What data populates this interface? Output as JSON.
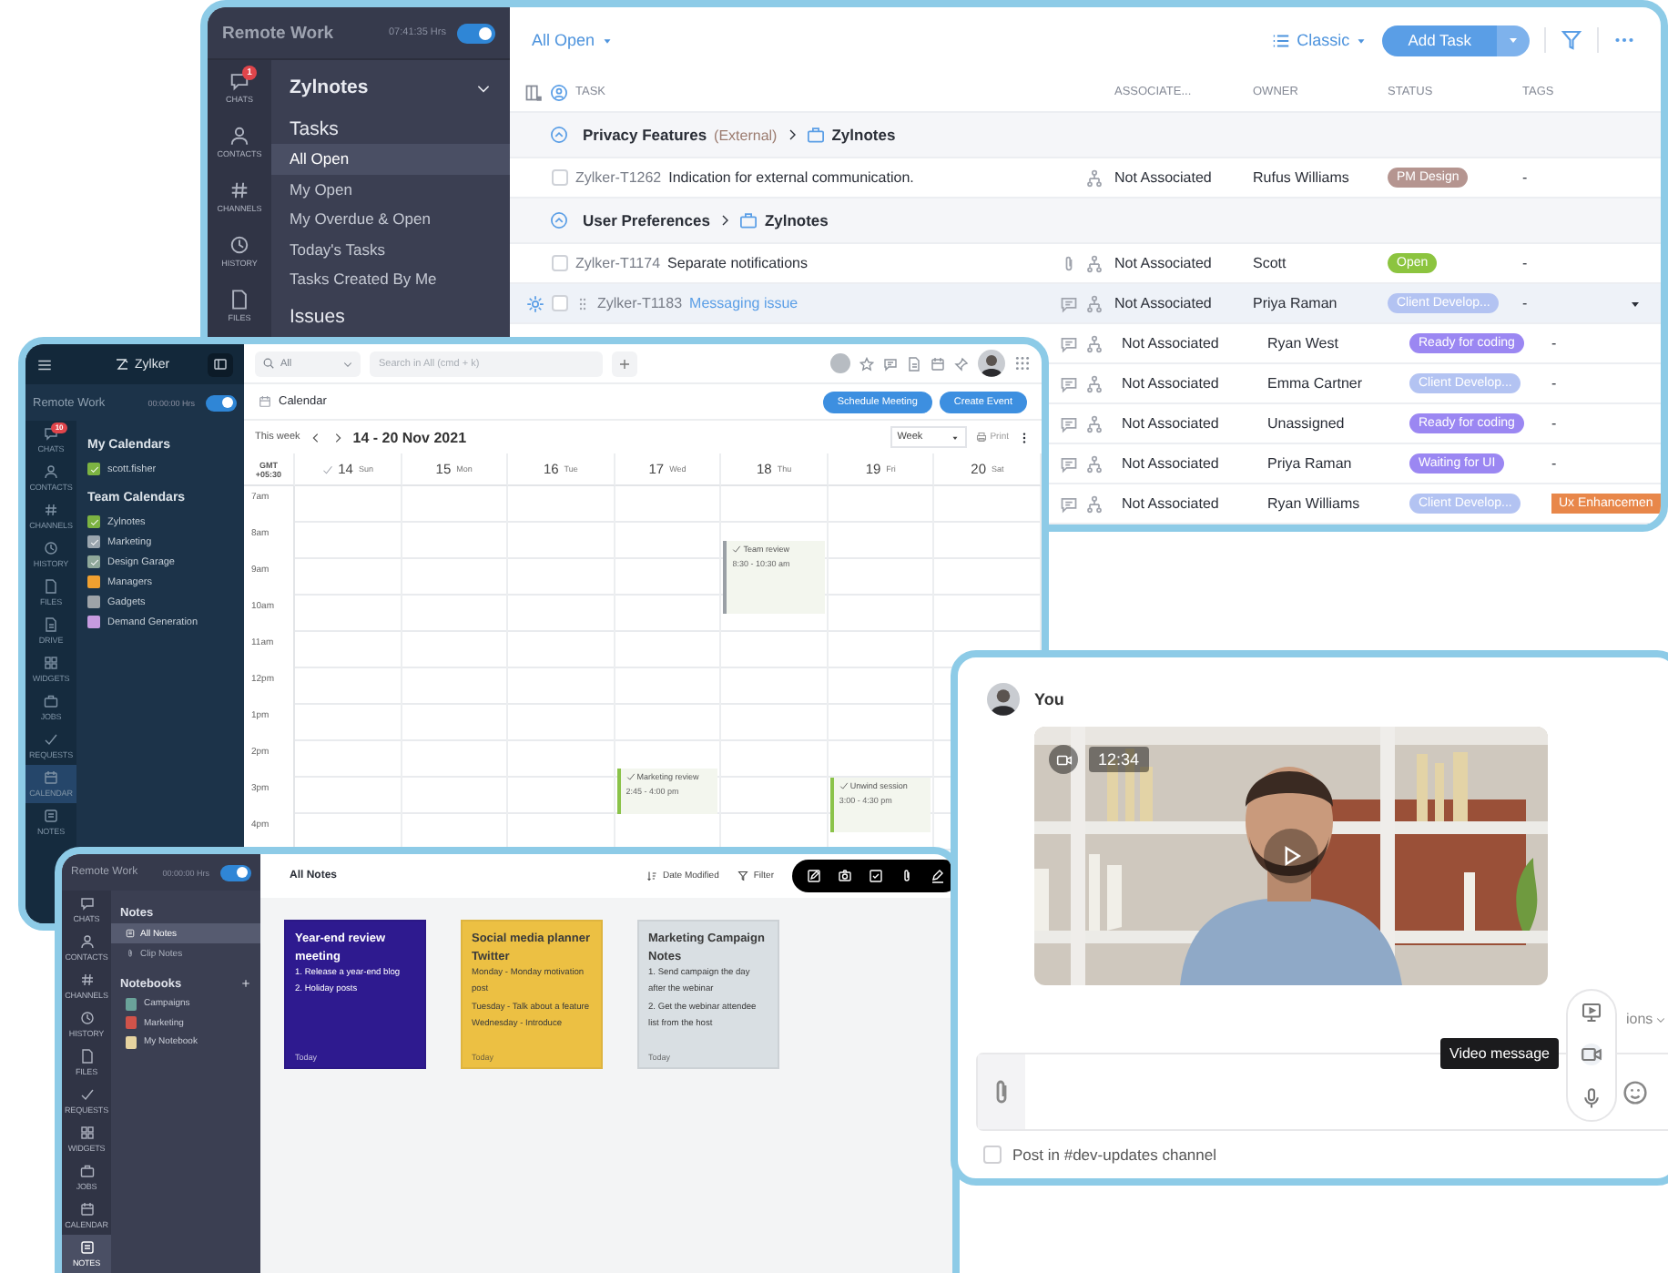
{
  "tasks_window": {
    "title": "Remote Work",
    "timer": "07:41:35 Hrs",
    "timer_on": true,
    "rail": [
      {
        "label": "CHATS",
        "badge": "1"
      },
      {
        "label": "CONTACTS"
      },
      {
        "label": "CHANNELS"
      },
      {
        "label": "HISTORY"
      },
      {
        "label": "FILES"
      }
    ],
    "project": "Zylnotes",
    "section": "Tasks",
    "views": [
      {
        "label": "All Open",
        "selected": true
      },
      {
        "label": "My Open",
        "selected": false
      },
      {
        "label": "My Overdue & Open",
        "selected": false
      },
      {
        "label": "Today's Tasks",
        "selected": false
      },
      {
        "label": "Tasks Created By Me",
        "selected": false
      }
    ],
    "section_2": "Issues",
    "filter_menu": "All Open",
    "layout_menu": "Classic",
    "add_button": "Add Task",
    "columns": [
      "TASK",
      "ASSOCIATE...",
      "OWNER",
      "STATUS",
      "TAGS"
    ],
    "rows": [
      {
        "kind": "group",
        "name": "Privacy Features",
        "note": "(External)",
        "project": "Zylnotes",
        "expanded": true
      },
      {
        "kind": "task",
        "id": "Zylker-T1262",
        "task": "Indication for external communication.",
        "commented": false,
        "attached": false,
        "associate": "Not Associated",
        "owner": "Rufus Williams",
        "status": {
          "label": "PM Design",
          "color": "#b59590"
        },
        "tags": "-",
        "selected": false
      },
      {
        "kind": "group",
        "name": "User Preferences",
        "project": "Zylnotes",
        "expanded": true
      },
      {
        "kind": "task",
        "id": "Zylker-T1174",
        "task": "Separate notifications",
        "commented": false,
        "attached": true,
        "associate": "Not Associated",
        "owner": "Scott",
        "status": {
          "label": "Open",
          "color": "#8cc43f"
        },
        "tags": "-",
        "selected": false
      },
      {
        "kind": "task",
        "id": "Zylker-T1183",
        "task": "Messaging issue",
        "commented": true,
        "attached": false,
        "associate": "Not Associated",
        "owner": "Priya Raman",
        "status": {
          "label": "Client Develop...",
          "color": "#b3c3f2"
        },
        "tags": "-",
        "selected": true
      },
      {
        "kind": "task",
        "commented": true,
        "attached": false,
        "associate": "Not Associated",
        "owner": "Ryan West",
        "status": {
          "label": "Ready for coding",
          "color": "#9b87f2"
        },
        "tags": "-",
        "selected": false
      },
      {
        "kind": "task",
        "commented": true,
        "attached": false,
        "associate": "Not Associated",
        "owner": "Emma Cartner",
        "status": {
          "label": "Client Develop...",
          "color": "#b3c3f2"
        },
        "tags": "-",
        "selected": false
      },
      {
        "kind": "task",
        "commented": true,
        "attached": false,
        "associate": "Not Associated",
        "owner": "Unassigned",
        "status": {
          "label": "Ready for coding",
          "color": "#9b87f2"
        },
        "tags": "-",
        "selected": false
      },
      {
        "kind": "task",
        "commented": true,
        "attached": false,
        "associate": "Not Associated",
        "owner": "Priya Raman",
        "status": {
          "label": "Waiting for UI",
          "color": "#9b87f2"
        },
        "tags": "-",
        "selected": false
      },
      {
        "kind": "task",
        "commented": true,
        "attached": false,
        "associate": "Not Associated",
        "owner": "Ryan Williams",
        "status": {
          "label": "Client Develop...",
          "color": "#b3c3f2"
        },
        "tag": {
          "label": "Ux Enhancemen",
          "color": "#e8874a"
        },
        "selected": false
      }
    ]
  },
  "calendar_window": {
    "app": "Zylker",
    "title": "Remote Work",
    "timer": "00:00:00 Hrs",
    "timer_on": true,
    "rail": [
      {
        "label": "CHATS",
        "badge": "10",
        "selected": false
      },
      {
        "label": "CONTACTS",
        "selected": false
      },
      {
        "label": "CHANNELS",
        "selected": false
      },
      {
        "label": "HISTORY",
        "selected": false
      },
      {
        "label": "FILES",
        "selected": false
      },
      {
        "label": "DRIVE",
        "selected": false
      },
      {
        "label": "WIDGETS",
        "selected": false
      },
      {
        "label": "JOBS",
        "selected": false
      },
      {
        "label": "REQUESTS",
        "selected": false
      },
      {
        "label": "CALENDAR",
        "selected": true
      },
      {
        "label": "NOTES",
        "selected": false
      }
    ],
    "my_calendars_title": "My Calendars",
    "my_calendars": [
      {
        "label": "scott.fisher",
        "color": "#7cb342",
        "checked": true
      }
    ],
    "team_calendars_title": "Team Calendars",
    "team_calendars": [
      {
        "label": "Zylnotes",
        "color": "#7cb342",
        "checked": true
      },
      {
        "label": "Marketing",
        "color": "#9aa5ae",
        "checked": true
      },
      {
        "label": "Design Garage",
        "color": "#8fa89a",
        "checked": true
      },
      {
        "label": "Managers",
        "color": "#f0a030",
        "checked": false
      },
      {
        "label": "Gadgets",
        "color": "#9ea3a8",
        "checked": false
      },
      {
        "label": "Demand Generation",
        "color": "#c79be0",
        "checked": false
      }
    ],
    "scope": "All",
    "search_placeholder": "Search in All (cmd + k)",
    "module": "Calendar",
    "actions": [
      "Schedule Meeting",
      "Create Event"
    ],
    "range_label": "This week",
    "range": "14 - 20 Nov 2021",
    "view": "Week",
    "print": "Print",
    "timezone": "GMT",
    "offset": "+05:30",
    "days": [
      {
        "date": "14",
        "day": "Sun"
      },
      {
        "date": "15",
        "day": "Mon"
      },
      {
        "date": "16",
        "day": "Tue"
      },
      {
        "date": "17",
        "day": "Wed",
        "events": [
          {
            "title": "Marketing review",
            "time": "2:45 - 4:00 pm",
            "color": "#8bc34a"
          }
        ]
      },
      {
        "date": "18",
        "day": "Thu",
        "events": [
          {
            "title": "Team review",
            "time": "8:30 - 10:30 am",
            "color": "#9aa0a6"
          }
        ]
      },
      {
        "date": "19",
        "day": "Fri",
        "events": [
          {
            "title": "Unwind session",
            "time": "3:00 - 4:30 pm",
            "color": "#8bc34a"
          }
        ]
      },
      {
        "date": "20",
        "day": "Sat"
      }
    ],
    "hours": [
      "7am",
      "8am",
      "9am",
      "10am",
      "11am",
      "12pm",
      "1pm",
      "2pm",
      "3pm",
      "4pm"
    ]
  },
  "notes_window": {
    "title": "Remote Work",
    "timer": "00:00:00 Hrs",
    "timer_on": true,
    "rail": [
      {
        "label": "CHATS",
        "selected": false
      },
      {
        "label": "CONTACTS",
        "selected": false
      },
      {
        "label": "CHANNELS",
        "selected": false
      },
      {
        "label": "HISTORY",
        "selected": false
      },
      {
        "label": "FILES",
        "selected": false
      },
      {
        "label": "REQUESTS",
        "selected": false
      },
      {
        "label": "WIDGETS",
        "selected": false
      },
      {
        "label": "JOBS",
        "selected": false
      },
      {
        "label": "CALENDAR",
        "selected": false
      },
      {
        "label": "NOTES",
        "selected": true
      }
    ],
    "notes_title": "Notes",
    "views": [
      {
        "label": "All Notes",
        "selected": true
      },
      {
        "label": "Clip Notes",
        "selected": false
      }
    ],
    "notebooks_title": "Notebooks",
    "notebooks": [
      {
        "label": "Campaigns",
        "color": "#6aa39a"
      },
      {
        "label": "Marketing",
        "color": "#d0534a"
      },
      {
        "label": "My Notebook",
        "color": "#e6d3a0"
      }
    ],
    "header": "All Notes",
    "sort": "Date Modified",
    "filter": "Filter",
    "cards": [
      {
        "title": "Year-end review meeting",
        "lines": [
          "1. Release a year-end blog",
          "2. Holiday posts"
        ],
        "date": "Today",
        "color": "#2e1a8f"
      },
      {
        "title": "Social media planner Twitter",
        "lines": [
          "Monday - Monday motivation post",
          "Tuesday - Talk about a feature",
          "Wednesday - Introduce"
        ],
        "date": "Today",
        "color": "#ecc043"
      },
      {
        "title": "Marketing Campaign Notes",
        "lines": [
          "1. Send campaign the day after the webinar",
          "2. Get the webinar attendee list from the host"
        ],
        "date": "Today",
        "color": "#d9dfe3"
      }
    ]
  },
  "chat_window": {
    "sender": "You",
    "video": {
      "duration": "12:34"
    },
    "options_fragment": "ions",
    "tooltip": "Video message",
    "post_option": {
      "label": "Post in #dev-updates channel",
      "checked": false
    }
  }
}
